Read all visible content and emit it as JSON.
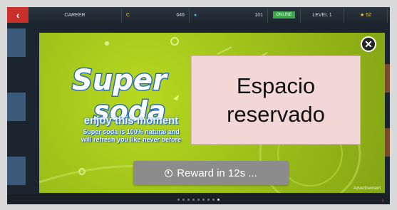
{
  "topbar": {
    "back_icon": "back-arrow-icon",
    "career": "CAREER",
    "money": "646",
    "gems": "101",
    "online": "ONLINE",
    "level": "LEVEL 1",
    "stars": "52"
  },
  "ad": {
    "logo_line1": "Super",
    "logo_line2": "soda",
    "tagline": "enjoy this moment",
    "subline1": "Super soda is 100% natural and",
    "subline2": "will refresh you like never before",
    "reward_button": "Reward in 12s ...",
    "ad_label": "Advertisement",
    "close_icon": "close-icon"
  },
  "placeholder": {
    "line1": "Espacio",
    "line2": "reservado"
  },
  "colors": {
    "ad_green": "#9ec21a",
    "logo_blue": "#2a6fb8",
    "button_gray": "#8c8c8c",
    "back_red": "#c9302c",
    "placeholder_pink": "#f2d7d6"
  }
}
